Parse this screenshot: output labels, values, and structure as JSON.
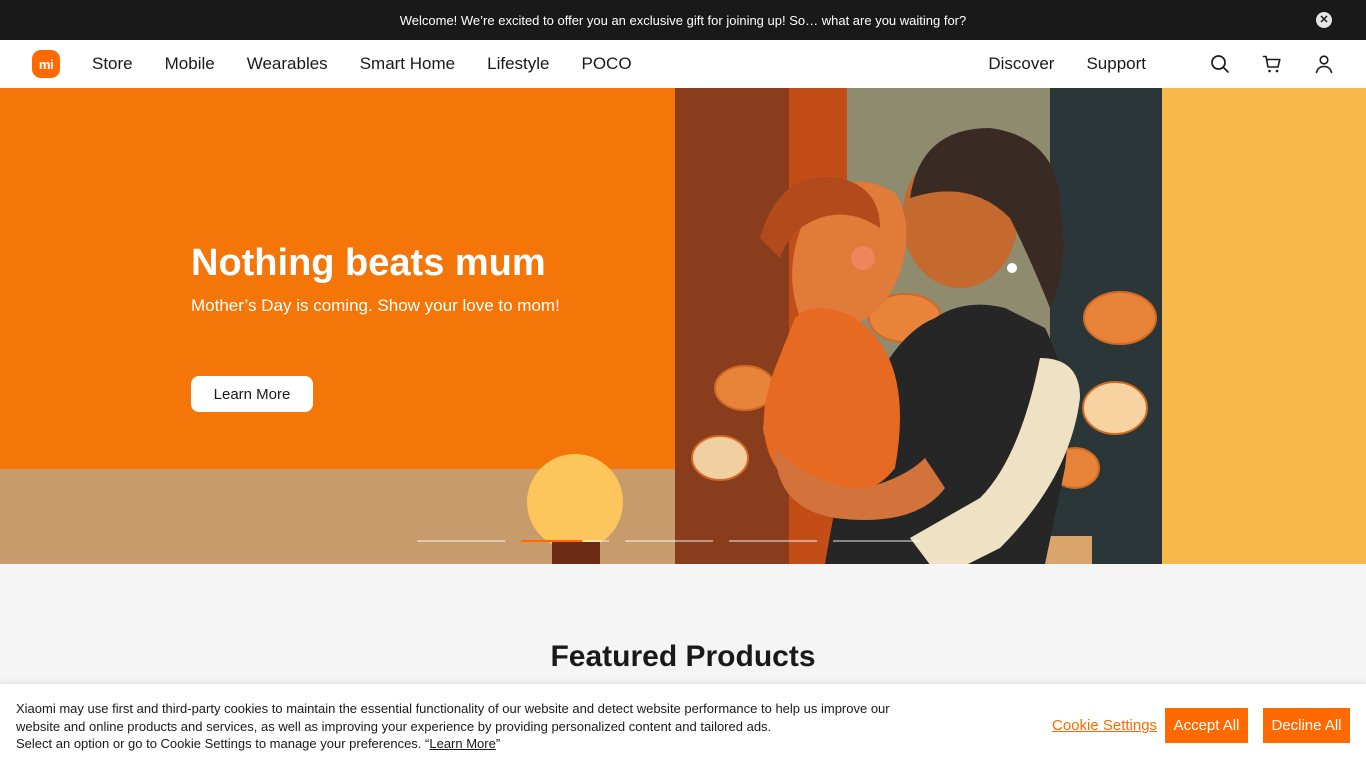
{
  "announcement": {
    "text": "Welcome! We’re excited to offer you an exclusive gift for joining up! So… what are you waiting for?"
  },
  "brand": {
    "logo_text": "mi",
    "color": "#ff6900"
  },
  "nav": {
    "left_items": [
      "Store",
      "Mobile",
      "Wearables",
      "Smart Home",
      "Lifestyle",
      "POCO"
    ],
    "right_items": [
      "Discover",
      "Support"
    ],
    "icons": [
      "search-icon",
      "cart-icon",
      "account-icon"
    ]
  },
  "hero": {
    "title": "Nothing beats mum",
    "subtitle": "Mother’s Day is coming. Show your love to mom!",
    "cta": "Learn More",
    "slide_count": 5,
    "active_slide": 2
  },
  "featured": {
    "title": "Featured Products"
  },
  "cookie_banner": {
    "text_line1": "Xiaomi may use first and third-party cookies to maintain the essential functionality of our website and detect website performance to help us improve our",
    "text_line2": "website and online products and services, as well as improving your experience by providing personalized content and tailored ads.",
    "text_line3_prefix": "Select an option or go to Cookie Settings to manage your preferences. “",
    "text_line3_link": "Learn More",
    "text_line3_suffix": "”",
    "settings_label": "Cookie Settings",
    "accept_label": "Accept All",
    "decline_label": "Decline All"
  }
}
